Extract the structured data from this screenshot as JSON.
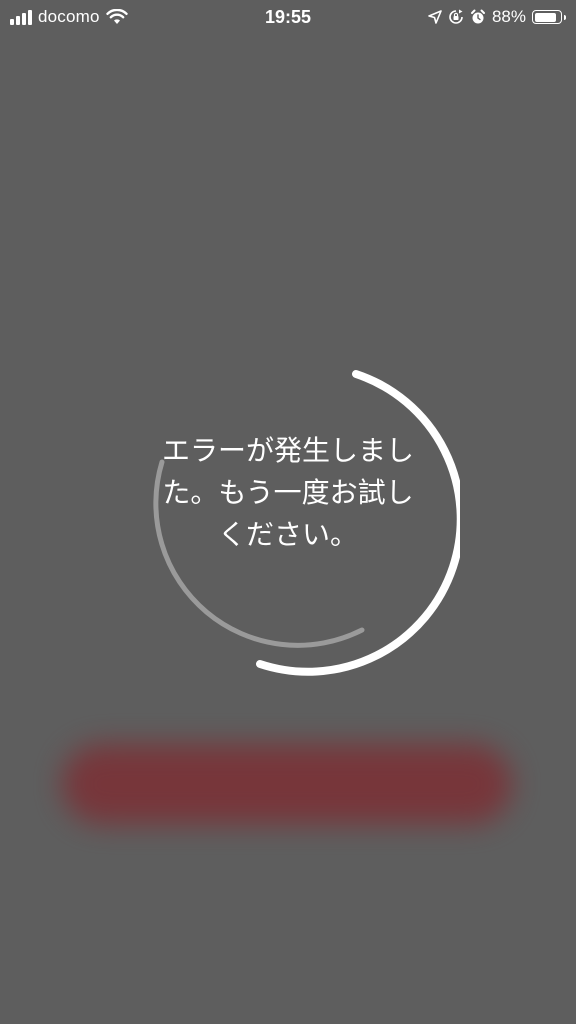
{
  "status_bar": {
    "carrier": "docomo",
    "time": "19:55",
    "battery_percent_label": "88%",
    "battery_level": 0.88,
    "icons": [
      "signal-icon",
      "wifi-icon",
      "location-icon",
      "orientation-lock-icon",
      "alarm-icon",
      "battery-icon"
    ]
  },
  "overlay": {
    "error_message": "エラーが発生しました。もう一度お試しください。"
  },
  "colors": {
    "background": "#5e5e5e",
    "spinner_primary": "#ffffff",
    "spinner_secondary": "#9a9a9a",
    "blurred_button": "#7a3237"
  }
}
